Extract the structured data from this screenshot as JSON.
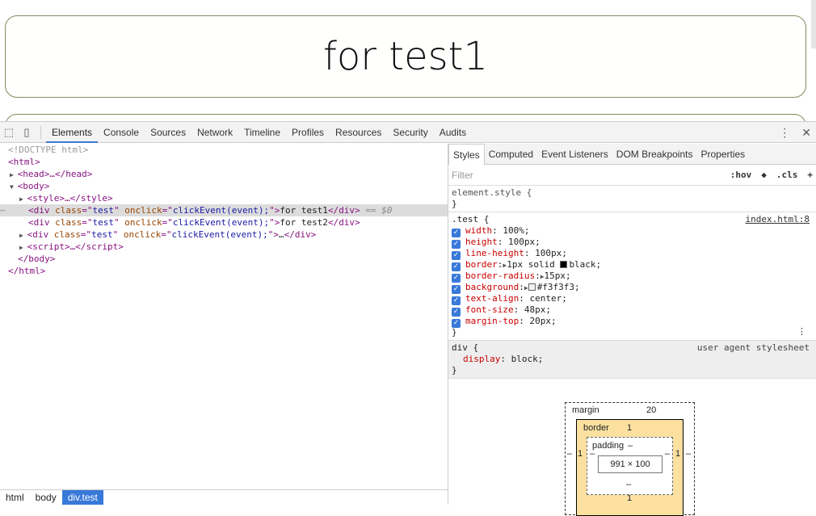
{
  "page": {
    "box1_text": "for test1"
  },
  "devtools": {
    "tabs": [
      "Elements",
      "Console",
      "Sources",
      "Network",
      "Timeline",
      "Profiles",
      "Resources",
      "Security",
      "Audits"
    ],
    "active_tab": "Elements",
    "dom": {
      "doctype": "<!DOCTYPE html>",
      "html_open": "<html>",
      "head": "<head>…</head>",
      "body_open": "<body>",
      "style": "<style>…</style>",
      "div_tag": "div",
      "class_attr": "class",
      "class_val": "test",
      "onclick_attr": "onclick",
      "onclick_val": "clickEvent(event);",
      "div1_text": "for test1",
      "div2_text": "for test2",
      "div3_text": "…",
      "selected_marker": "== $0",
      "script": "<script>…</script>",
      "body_close": "</body>",
      "html_close": "</html>"
    },
    "breadcrumbs": [
      "html",
      "body",
      "div.test"
    ],
    "styles": {
      "tabs": [
        "Styles",
        "Computed",
        "Event Listeners",
        "DOM Breakpoints",
        "Properties"
      ],
      "filter_placeholder": "Filter",
      "hov": ":hov",
      "cls": ".cls",
      "add": "+",
      "element_style": "element.style {",
      "close_brace": "}",
      "test_selector": ".test {",
      "test_source": "index.html:8",
      "test_props": [
        {
          "name": "width",
          "value": "100%;"
        },
        {
          "name": "height",
          "value": "100px;"
        },
        {
          "name": "line-height",
          "value": "100px;"
        },
        {
          "name": "border",
          "value": "1px solid black;"
        },
        {
          "name": "border-radius",
          "value": "15px;"
        },
        {
          "name": "background",
          "value": "#f3f3f3;"
        },
        {
          "name": "text-align",
          "value": "center;"
        },
        {
          "name": "font-size",
          "value": "48px;"
        },
        {
          "name": "margin-top",
          "value": "20px;"
        }
      ],
      "div_selector": "div {",
      "div_source": "user agent stylesheet",
      "div_prop": {
        "name": "display",
        "value": "block;"
      }
    },
    "box_model": {
      "margin_label": "margin",
      "margin_top": "20",
      "border_label": "border",
      "border_top": "1",
      "border_left": "1",
      "border_right": "1",
      "border_bottom": "1",
      "padding_label": "padding",
      "padding_top": "–",
      "padding_bottom": "–",
      "margin_left": "–",
      "margin_right": "–",
      "padding_left": "–",
      "padding_right": "–",
      "content": "991 × 100"
    },
    "colors": {
      "accent": "#3879d9",
      "border_box": "#fbe0a0"
    }
  }
}
